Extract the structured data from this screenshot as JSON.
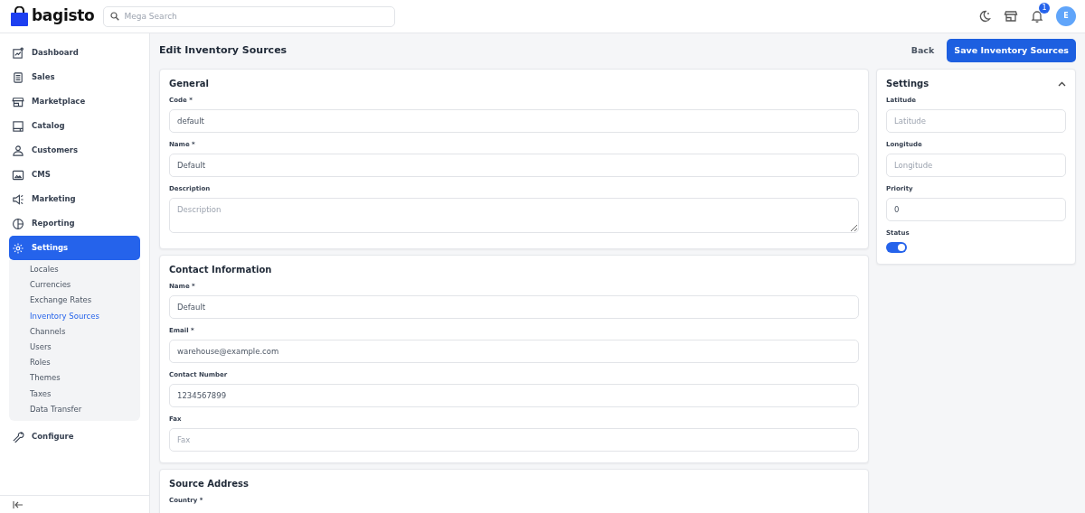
{
  "header": {
    "logo": "bagisto",
    "search": {
      "placeholder": "Mega Search"
    },
    "notification_count": "1",
    "avatar": "E"
  },
  "sidebar": {
    "items": [
      {
        "label": "Dashboard",
        "selected": false
      },
      {
        "label": "Sales",
        "selected": false
      },
      {
        "label": "Marketplace",
        "selected": false
      },
      {
        "label": "Catalog",
        "selected": false
      },
      {
        "label": "Customers",
        "selected": false
      },
      {
        "label": "CMS",
        "selected": false
      },
      {
        "label": "Marketing",
        "selected": false
      },
      {
        "label": "Reporting",
        "selected": false
      },
      {
        "label": "Settings",
        "selected": true,
        "children": [
          {
            "label": "Locales",
            "selected": false
          },
          {
            "label": "Currencies",
            "selected": false
          },
          {
            "label": "Exchange Rates",
            "selected": false
          },
          {
            "label": "Inventory Sources",
            "selected": true
          },
          {
            "label": "Channels",
            "selected": false
          },
          {
            "label": "Users",
            "selected": false
          },
          {
            "label": "Roles",
            "selected": false
          },
          {
            "label": "Themes",
            "selected": false
          },
          {
            "label": "Taxes",
            "selected": false
          },
          {
            "label": "Data Transfer",
            "selected": false
          }
        ]
      },
      {
        "label": "Configure",
        "selected": false
      }
    ]
  },
  "page": {
    "title": "Edit Inventory Sources",
    "buttons": [
      {
        "label": "Back",
        "kind": "link"
      },
      {
        "label": "Save Inventory Sources",
        "kind": "primary"
      }
    ]
  },
  "sections": [
    {
      "title": "General",
      "fields": [
        {
          "label": "Code *",
          "kind": "input",
          "value": "default"
        },
        {
          "label": "Name *",
          "kind": "input",
          "value": "Default"
        },
        {
          "label": "Description",
          "kind": "textarea",
          "placeholder": "Description"
        }
      ]
    },
    {
      "title": "Contact Information",
      "fields": [
        {
          "label": "Name *",
          "kind": "input",
          "value": "Default"
        },
        {
          "label": "Email *",
          "kind": "input",
          "value": "warehouse@example.com"
        },
        {
          "label": "Contact Number",
          "kind": "input",
          "value": "1234567899"
        },
        {
          "label": "Fax",
          "kind": "input",
          "placeholder": "Fax"
        }
      ]
    },
    {
      "title": "Source Address",
      "fields": [
        {
          "label": "Country *",
          "kind": "label"
        }
      ]
    }
  ],
  "settings_panel": {
    "title": "Settings",
    "expanded": true,
    "fields": [
      {
        "label": "Latitude",
        "kind": "input",
        "placeholder": "Latitude"
      },
      {
        "label": "Longitude",
        "kind": "input",
        "placeholder": "Longitude"
      },
      {
        "label": "Priority",
        "kind": "input",
        "value": "0"
      },
      {
        "label": "Status",
        "kind": "toggle",
        "on": true
      }
    ]
  }
}
